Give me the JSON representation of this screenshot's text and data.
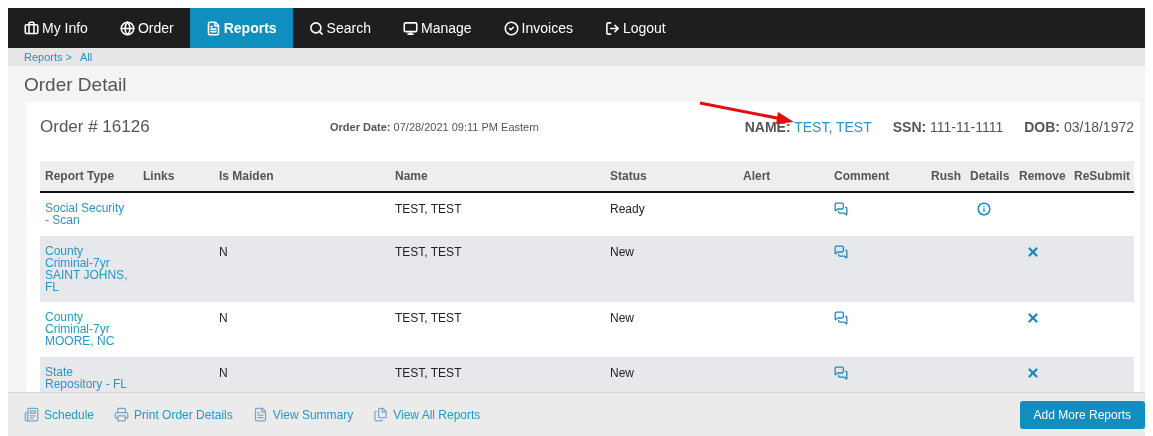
{
  "nav": [
    {
      "label": "My Info",
      "selected": false
    },
    {
      "label": "Order",
      "selected": false
    },
    {
      "label": "Reports",
      "selected": true
    },
    {
      "label": "Search",
      "selected": false
    },
    {
      "label": "Manage",
      "selected": false
    },
    {
      "label": "Invoices",
      "selected": false
    },
    {
      "label": "Logout",
      "selected": false
    }
  ],
  "breadcrumb": [
    "Reports >",
    "All"
  ],
  "page_title": "Order Detail",
  "order": {
    "number": "Order # 16126",
    "date_label": "Order Date:",
    "date": "07/28/2021 09:11 PM",
    "timezone": "Eastern",
    "fields": [
      {
        "label": "NAME:",
        "value": "TEST, TEST",
        "kind": "link"
      },
      {
        "label": "SSN:",
        "value": "111-11-1111",
        "kind": "text"
      },
      {
        "label": "DOB:",
        "value": "03/18/1972",
        "kind": "text"
      }
    ]
  },
  "table": {
    "columns": [
      "Report Type",
      "Links",
      "Is Maiden",
      "Name",
      "Status",
      "Alert",
      "Comment",
      "Rush",
      "Details",
      "Remove",
      "ReSubmit"
    ],
    "rows": [
      {
        "report_type": "Social Security - Scan",
        "name": "TEST, TEST",
        "status": "Ready",
        "comment": true,
        "details": true,
        "remove": false
      },
      {
        "report_type": "County Criminal-7yr SAINT JOHNS, FL",
        "is_maiden": "N",
        "name": "TEST, TEST",
        "status": "New",
        "comment": true,
        "details": false,
        "remove": true
      },
      {
        "report_type": "County Criminal-7yr MOORE, NC",
        "is_maiden": "N",
        "name": "TEST, TEST",
        "status": "New",
        "comment": true,
        "details": false,
        "remove": true
      },
      {
        "report_type": "State Repository - FL",
        "is_maiden": "N",
        "name": "TEST, TEST",
        "status": "New",
        "comment": true,
        "details": false,
        "remove": true
      }
    ]
  },
  "footer": {
    "links": [
      "Schedule",
      "Print Order Details",
      "View Summary",
      "View All Reports"
    ],
    "button": "Add More Reports"
  }
}
